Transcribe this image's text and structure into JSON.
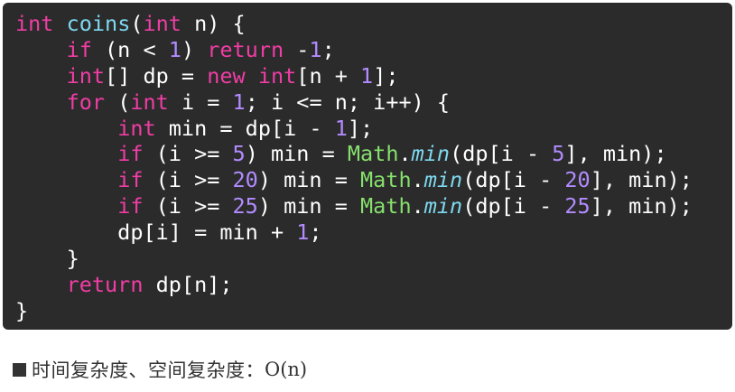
{
  "code": {
    "lines": [
      [
        {
          "t": "int",
          "c": "type"
        },
        {
          "t": " ",
          "c": "plain"
        },
        {
          "t": "coins",
          "c": "fn"
        },
        {
          "t": "(",
          "c": "plain"
        },
        {
          "t": "int",
          "c": "type"
        },
        {
          "t": " n) {",
          "c": "plain"
        }
      ],
      [
        {
          "t": "    ",
          "c": "plain"
        },
        {
          "t": "if",
          "c": "keyword"
        },
        {
          "t": " (n < ",
          "c": "plain"
        },
        {
          "t": "1",
          "c": "number"
        },
        {
          "t": ") ",
          "c": "plain"
        },
        {
          "t": "return",
          "c": "keyword"
        },
        {
          "t": " -",
          "c": "plain"
        },
        {
          "t": "1",
          "c": "number"
        },
        {
          "t": ";",
          "c": "plain"
        }
      ],
      [
        {
          "t": "    ",
          "c": "plain"
        },
        {
          "t": "int",
          "c": "type"
        },
        {
          "t": "[] dp = ",
          "c": "plain"
        },
        {
          "t": "new",
          "c": "keyword"
        },
        {
          "t": " ",
          "c": "plain"
        },
        {
          "t": "int",
          "c": "type"
        },
        {
          "t": "[n + ",
          "c": "plain"
        },
        {
          "t": "1",
          "c": "number"
        },
        {
          "t": "];",
          "c": "plain"
        }
      ],
      [
        {
          "t": "    ",
          "c": "plain"
        },
        {
          "t": "for",
          "c": "keyword"
        },
        {
          "t": " (",
          "c": "plain"
        },
        {
          "t": "int",
          "c": "type"
        },
        {
          "t": " i = ",
          "c": "plain"
        },
        {
          "t": "1",
          "c": "number"
        },
        {
          "t": "; i <= n; i++) {",
          "c": "plain"
        }
      ],
      [
        {
          "t": "        ",
          "c": "plain"
        },
        {
          "t": "int",
          "c": "type"
        },
        {
          "t": " min = dp[i - ",
          "c": "plain"
        },
        {
          "t": "1",
          "c": "number"
        },
        {
          "t": "];",
          "c": "plain"
        }
      ],
      [
        {
          "t": "        ",
          "c": "plain"
        },
        {
          "t": "if",
          "c": "keyword"
        },
        {
          "t": " (i >= ",
          "c": "plain"
        },
        {
          "t": "5",
          "c": "number"
        },
        {
          "t": ") min = ",
          "c": "plain"
        },
        {
          "t": "Math",
          "c": "class"
        },
        {
          "t": ".",
          "c": "plain"
        },
        {
          "t": "min",
          "c": "method"
        },
        {
          "t": "(dp[i - ",
          "c": "plain"
        },
        {
          "t": "5",
          "c": "number"
        },
        {
          "t": "], min);",
          "c": "plain"
        }
      ],
      [
        {
          "t": "        ",
          "c": "plain"
        },
        {
          "t": "if",
          "c": "keyword"
        },
        {
          "t": " (i >= ",
          "c": "plain"
        },
        {
          "t": "20",
          "c": "number"
        },
        {
          "t": ") min = ",
          "c": "plain"
        },
        {
          "t": "Math",
          "c": "class"
        },
        {
          "t": ".",
          "c": "plain"
        },
        {
          "t": "min",
          "c": "method"
        },
        {
          "t": "(dp[i - ",
          "c": "plain"
        },
        {
          "t": "20",
          "c": "number"
        },
        {
          "t": "], min);",
          "c": "plain"
        }
      ],
      [
        {
          "t": "        ",
          "c": "plain"
        },
        {
          "t": "if",
          "c": "keyword"
        },
        {
          "t": " (i >= ",
          "c": "plain"
        },
        {
          "t": "25",
          "c": "number"
        },
        {
          "t": ") min = ",
          "c": "plain"
        },
        {
          "t": "Math",
          "c": "class"
        },
        {
          "t": ".",
          "c": "plain"
        },
        {
          "t": "min",
          "c": "method"
        },
        {
          "t": "(dp[i - ",
          "c": "plain"
        },
        {
          "t": "25",
          "c": "number"
        },
        {
          "t": "], min);",
          "c": "plain"
        }
      ],
      [
        {
          "t": "        dp[i] = min + ",
          "c": "plain"
        },
        {
          "t": "1",
          "c": "number"
        },
        {
          "t": ";",
          "c": "plain"
        }
      ],
      [
        {
          "t": "    }",
          "c": "plain"
        }
      ],
      [
        {
          "t": "    ",
          "c": "plain"
        },
        {
          "t": "return",
          "c": "keyword"
        },
        {
          "t": " dp[n];",
          "c": "plain"
        }
      ],
      [
        {
          "t": "}",
          "c": "plain"
        }
      ]
    ],
    "colors": {
      "background": "#2b2b2b",
      "keyword": "#f03da5",
      "function": "#7ed8f0",
      "number": "#b28cff",
      "class": "#86e06c",
      "plain": "#ffffff"
    }
  },
  "complexity": {
    "label": "时间复杂度、空间复杂度：",
    "value": "O(n)"
  }
}
